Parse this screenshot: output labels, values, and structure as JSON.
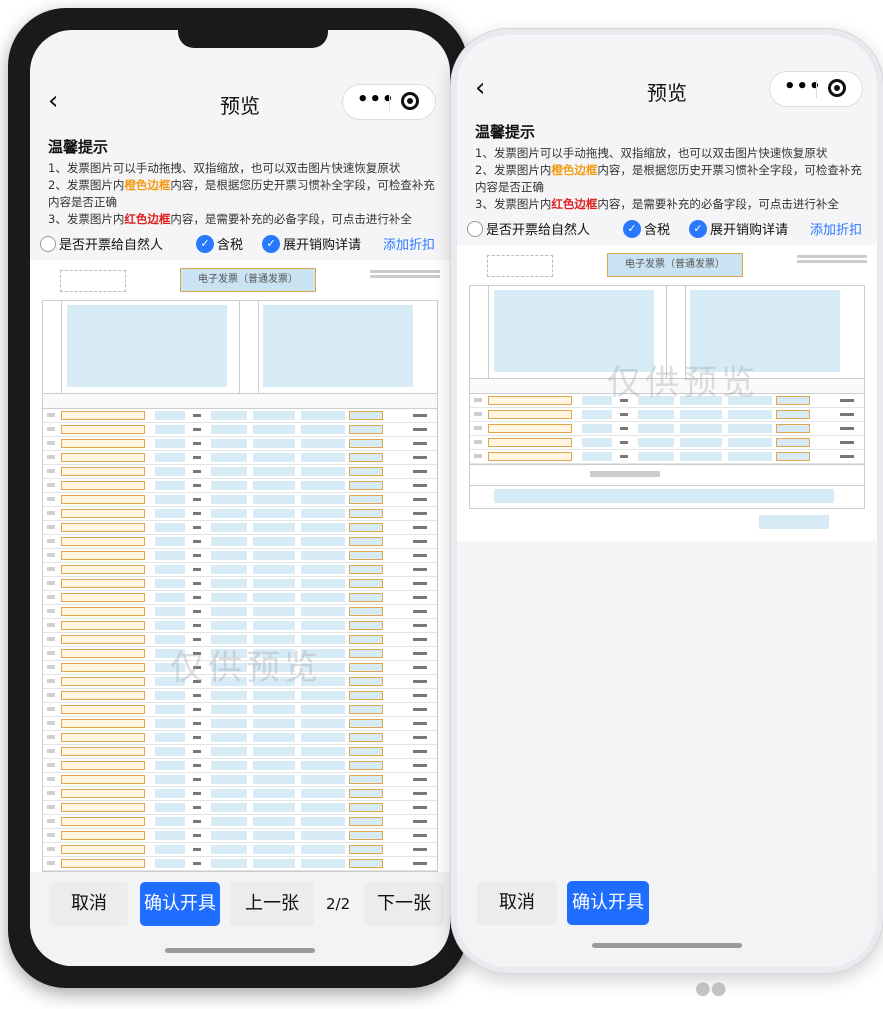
{
  "nav": {
    "back": "‹",
    "title": "预览",
    "more": "•••"
  },
  "tips": {
    "heading": "温馨提示",
    "line1": "1、发票图片可以手动拖拽、双指缩放，也可以双击图片快速恢复原状",
    "line2_a": "2、发票图片内",
    "line2_b": "橙色边框",
    "line2_c": "内容，是根据您历史开票习惯补全字段，可检查补充内容是否正确",
    "line3_a": "3、发票图片内",
    "line3_b": "红色边框",
    "line3_c": "内容，是需要补充的必备字段，可点击进行补全"
  },
  "options": {
    "natural_person": "是否开票给自然人",
    "tax_included": "含税",
    "expand_details": "展开销购详请",
    "add_discount": "添加折扣"
  },
  "invoice": {
    "title": "电子发票（普通发票）",
    "watermark": "仅供预览"
  },
  "buttons": {
    "cancel": "取消",
    "confirm": "确认开具",
    "prev": "上一张",
    "next": "下一张"
  },
  "pager": "2/2",
  "colors": {
    "primary": "#1f6dff",
    "orange": "#f39c12",
    "red": "#e02020",
    "invoice_fill": "#d6ebf5"
  }
}
